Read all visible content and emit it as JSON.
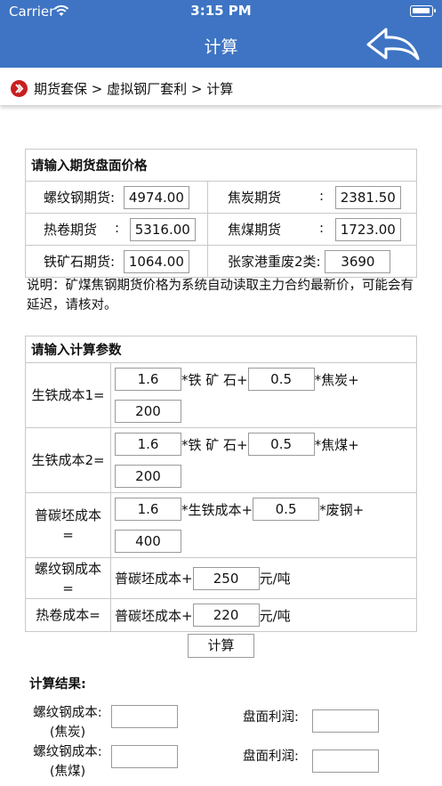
{
  "status_bar": {
    "carrier": "Carrier",
    "time": "3:15 PM"
  },
  "nav": {
    "title": "计算"
  },
  "breadcrumb": {
    "text": "期货套保 > 虚拟钢厂套利 > 计算"
  },
  "prices": {
    "header": "请输入期货盘面价格",
    "rows": [
      {
        "left_label": "螺纹钢期货:",
        "left_value": "4974.00",
        "right_label": "焦炭期货",
        "right_colon": ":",
        "right_value": "2381.50"
      },
      {
        "left_label": "热卷期货",
        "left_colon": ":",
        "left_value": "5316.00",
        "right_label": "焦煤期货",
        "right_colon": ":",
        "right_value": "1723.00"
      },
      {
        "left_label": "铁矿石期货:",
        "left_value": "1064.00",
        "right_label": "张家港重废2类:",
        "right_value": "3690"
      }
    ],
    "note": "说明：矿煤焦钢期货价格为系统自动读取主力合约最新价，可能会有延迟，请核对。"
  },
  "params": {
    "header": "请输入计算参数",
    "pig_iron_1": {
      "label": "生铁成本1=",
      "coef_a": "1.6",
      "text_a": "*铁 矿 石+",
      "coef_b": "0.5",
      "text_b": "*焦炭+",
      "constant": "200"
    },
    "pig_iron_2": {
      "label": "生铁成本2=",
      "coef_a": "1.6",
      "text_a": "*铁 矿 石+",
      "coef_b": "0.5",
      "text_b": "*焦煤+",
      "constant": "200"
    },
    "billet": {
      "label_1": "普碳坯成本",
      "label_2": "=",
      "coef_a": "1.6",
      "text_a": "*生铁成本+",
      "coef_b": "0.5",
      "text_b": "*废钢+",
      "constant": "400"
    },
    "rebar": {
      "label_1": "螺纹钢成本",
      "label_2": "=",
      "text": "普碳坯成本+",
      "value": "250",
      "unit": "元/吨"
    },
    "hrc": {
      "label": "热卷成本=",
      "text": "普碳坯成本+",
      "value": "220",
      "unit": "元/吨"
    }
  },
  "calc_button": "计算",
  "results": {
    "title": "计算结果:",
    "rebar_coke_label_1": "螺纹钢成本:",
    "rebar_coke_label_2": "(焦炭)",
    "profit_label": "盘面利润:",
    "rebar_coal_label_1": "螺纹钢成本:",
    "rebar_coal_label_2": "(焦煤)",
    "profit_label_2": "盘面利润:"
  }
}
